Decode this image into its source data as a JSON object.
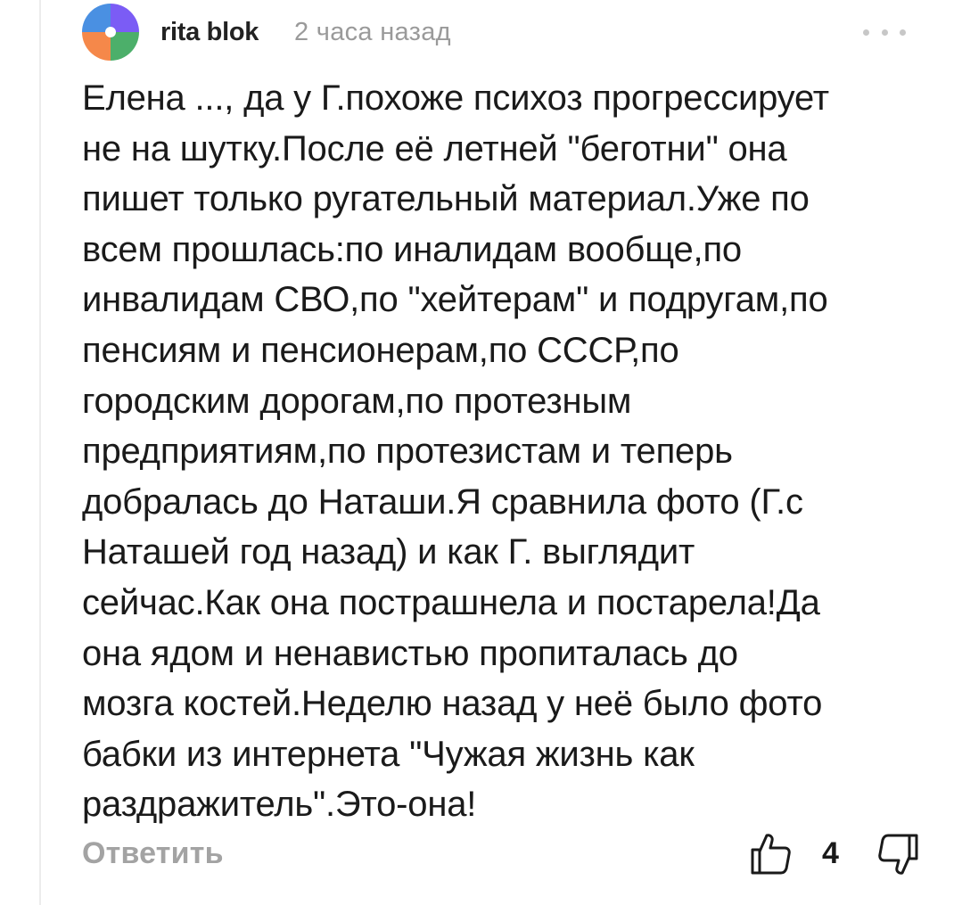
{
  "comment": {
    "author": "rita blok",
    "time": "2 часа назад",
    "text_lines": [
      "Елена ..., да у Г.похоже психоз прогрессирует",
      "не на шутку.После её летней \"беготни\" она",
      "пишет только ругательный материал.Уже по",
      "всем прошлась:по иналидам вообще,по",
      "инвалидам СВО,по \"хейтерам\" и подругам,по",
      "пенсиям и пенсионерам,по СССР,по",
      "городским дорогам,по протезным",
      "предприятиям,по протезистам и теперь",
      "добралась до Наташи.Я сравнила фото (Г.с",
      "Наташей год назад) и как Г. выглядит",
      "сейчас.Как она пострашнела и постарела!Да",
      "она ядом и ненавистью пропиталась до",
      "мозга костей.Неделю назад у неё было фото",
      "бабки из интернета \"Чужая жизнь как",
      "раздражитель\".Это-она!"
    ],
    "reply_label": "Ответить",
    "like_count": "4"
  },
  "icons": {
    "avatar": "avatar-quadrants",
    "more": "more-dots-icon",
    "like": "thumbs-up-icon",
    "dislike": "thumbs-down-icon"
  },
  "colors": {
    "avatar_purple": "#7b5cf5",
    "avatar_blue": "#4a90e2",
    "avatar_orange": "#f5884a",
    "avatar_green": "#4caf6a",
    "muted_text": "#9a9a9a"
  }
}
